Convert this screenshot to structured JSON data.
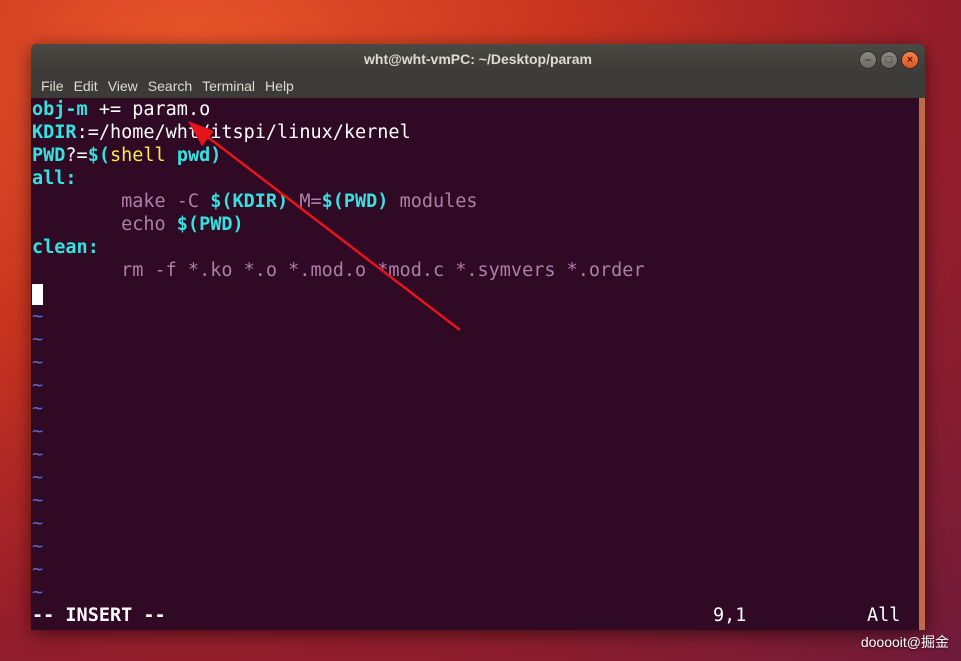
{
  "window": {
    "title": "wht@wht-vmPC: ~/Desktop/param",
    "buttons": [
      "–",
      "□",
      "×"
    ]
  },
  "menubar": {
    "items": [
      "File",
      "Edit",
      "View",
      "Search",
      "Terminal",
      "Help"
    ]
  },
  "editor": {
    "lines": [
      [
        {
          "t": "obj-m",
          "c": "kw"
        },
        {
          "t": " += param.o",
          "c": ""
        }
      ],
      [
        {
          "t": "KDIR",
          "c": "kw"
        },
        {
          "t": ":=/home/wht/itspi/linux/kernel",
          "c": ""
        }
      ],
      [
        {
          "t": "PWD",
          "c": "kw"
        },
        {
          "t": "?=",
          "c": ""
        },
        {
          "t": "$(",
          "c": "cy"
        },
        {
          "t": "shell",
          "c": "yl"
        },
        {
          "t": " pwd)",
          "c": "cy"
        }
      ],
      [
        {
          "t": "all:",
          "c": "kw"
        }
      ],
      [
        {
          "t": "        make -C ",
          "c": "mg"
        },
        {
          "t": "$(KDIR)",
          "c": "cy"
        },
        {
          "t": " M=",
          "c": "mg"
        },
        {
          "t": "$(PWD)",
          "c": "cy"
        },
        {
          "t": " modules",
          "c": "mg"
        }
      ],
      [
        {
          "t": "        echo ",
          "c": "mg"
        },
        {
          "t": "$(PWD)",
          "c": "cy"
        }
      ],
      [
        {
          "t": "clean:",
          "c": "kw"
        }
      ],
      [
        {
          "t": "        rm -f *.ko *.o *.mod.o *mod.c *.symvers *.order",
          "c": "mg"
        }
      ]
    ],
    "empty_line_marker": "~",
    "empty_line_count": 13,
    "mode": "-- INSERT --",
    "cursor_position": "9,1",
    "scroll_position": "All"
  },
  "watermark": "dooooit@掘金"
}
